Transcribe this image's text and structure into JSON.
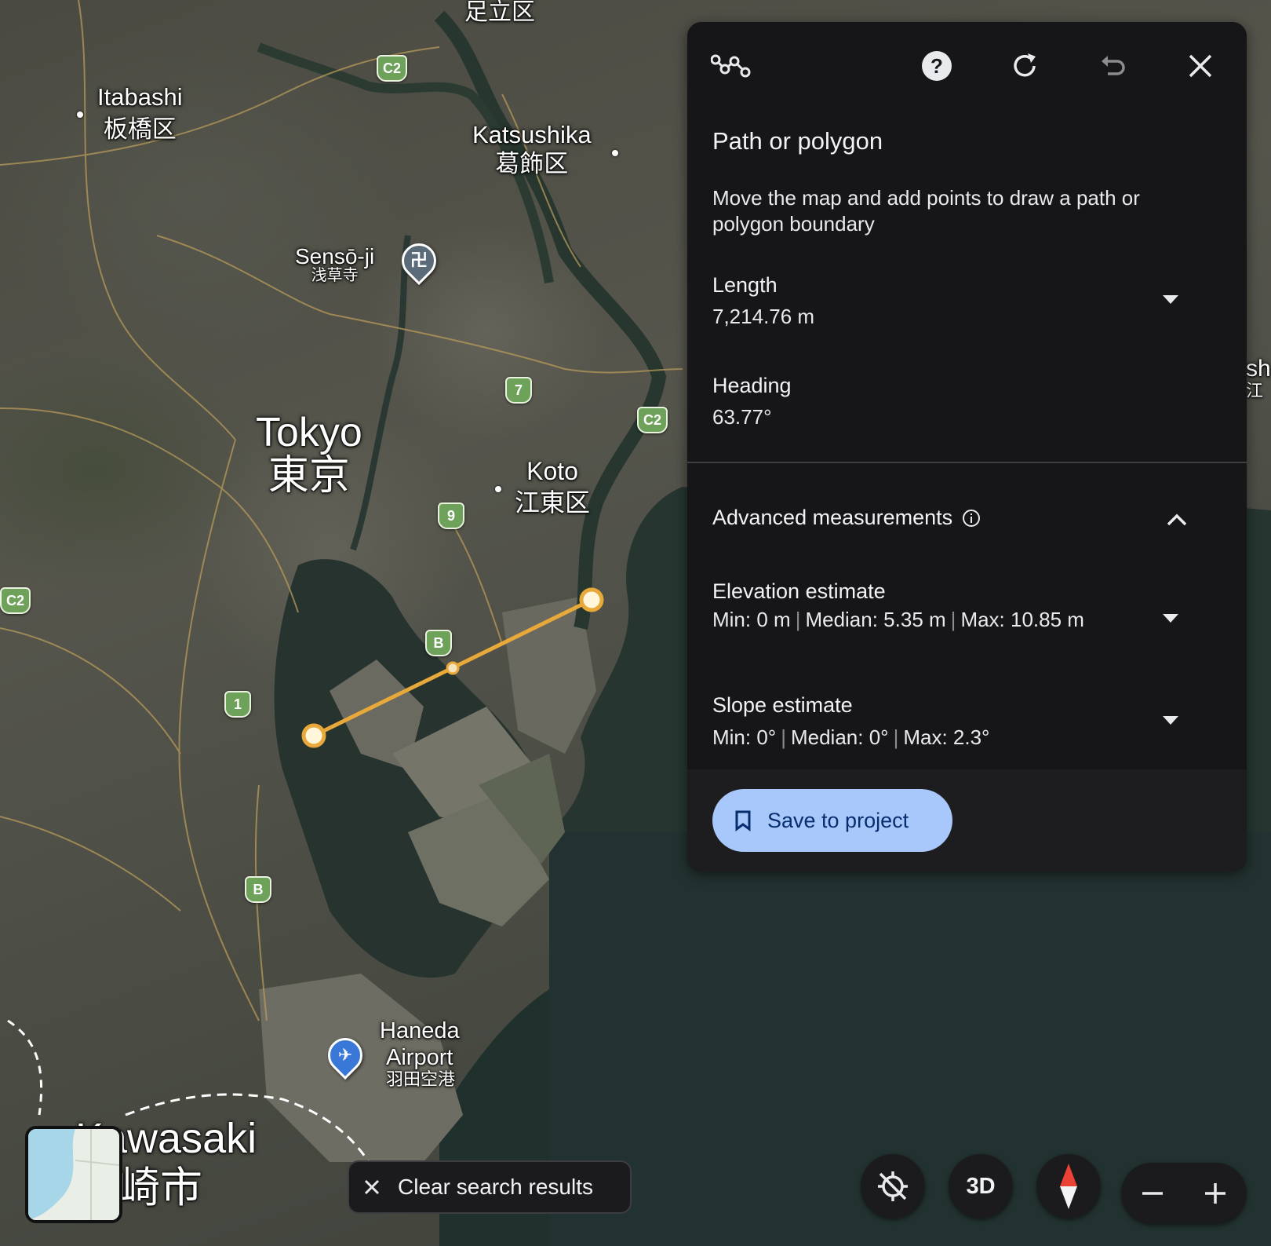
{
  "panel": {
    "title": "Path or polygon",
    "description": "Move the map and add points to draw a path or polygon boundary",
    "length": {
      "label": "Length",
      "value": "7,214.76 m"
    },
    "heading": {
      "label": "Heading",
      "value": "63.77°"
    },
    "advanced": {
      "title": "Advanced measurements",
      "elevation": {
        "label": "Elevation estimate",
        "min": "Min: 0 m",
        "median": "Median: 5.35 m",
        "max": "Max: 10.85 m"
      },
      "slope": {
        "label": "Slope estimate",
        "min": "Min: 0°",
        "median": "Median: 0°",
        "max": "Max: 2.3°"
      }
    },
    "save_label": "Save to project"
  },
  "map": {
    "places": {
      "adachi": "足立区",
      "itabashi_en": "Itabashi",
      "itabashi_jp": "板橋区",
      "katsushika_en": "Katsushika",
      "katsushika_jp": "葛飾区",
      "sensoji_en": "Sensō-ji",
      "sensoji_jp": "浅草寺",
      "tokyo_en": "Tokyo",
      "tokyo_jp": "東京",
      "koto_en": "Koto",
      "koto_jp": "江東区",
      "haneda_en1": "Haneda",
      "haneda_en2": "Airport",
      "haneda_jp": "羽田空港",
      "kawasaki_en": "Kawasaki",
      "kawasaki_jp": "川崎市",
      "edge_en": "sh",
      "edge_jp": "江"
    },
    "shields": [
      "C2",
      "C2",
      "C2",
      "C2",
      "7",
      "9",
      "B",
      "1",
      "B"
    ],
    "sensoji_glyph": "卍"
  },
  "controls": {
    "clear_search": "Clear search results",
    "view_3d": "3D"
  },
  "colors": {
    "panel_bg": "#161618",
    "save_button": "#a8c7fa",
    "path_line": "#e8a93a",
    "shield_green": "#6ea15a",
    "compass_red": "#ea4335"
  }
}
